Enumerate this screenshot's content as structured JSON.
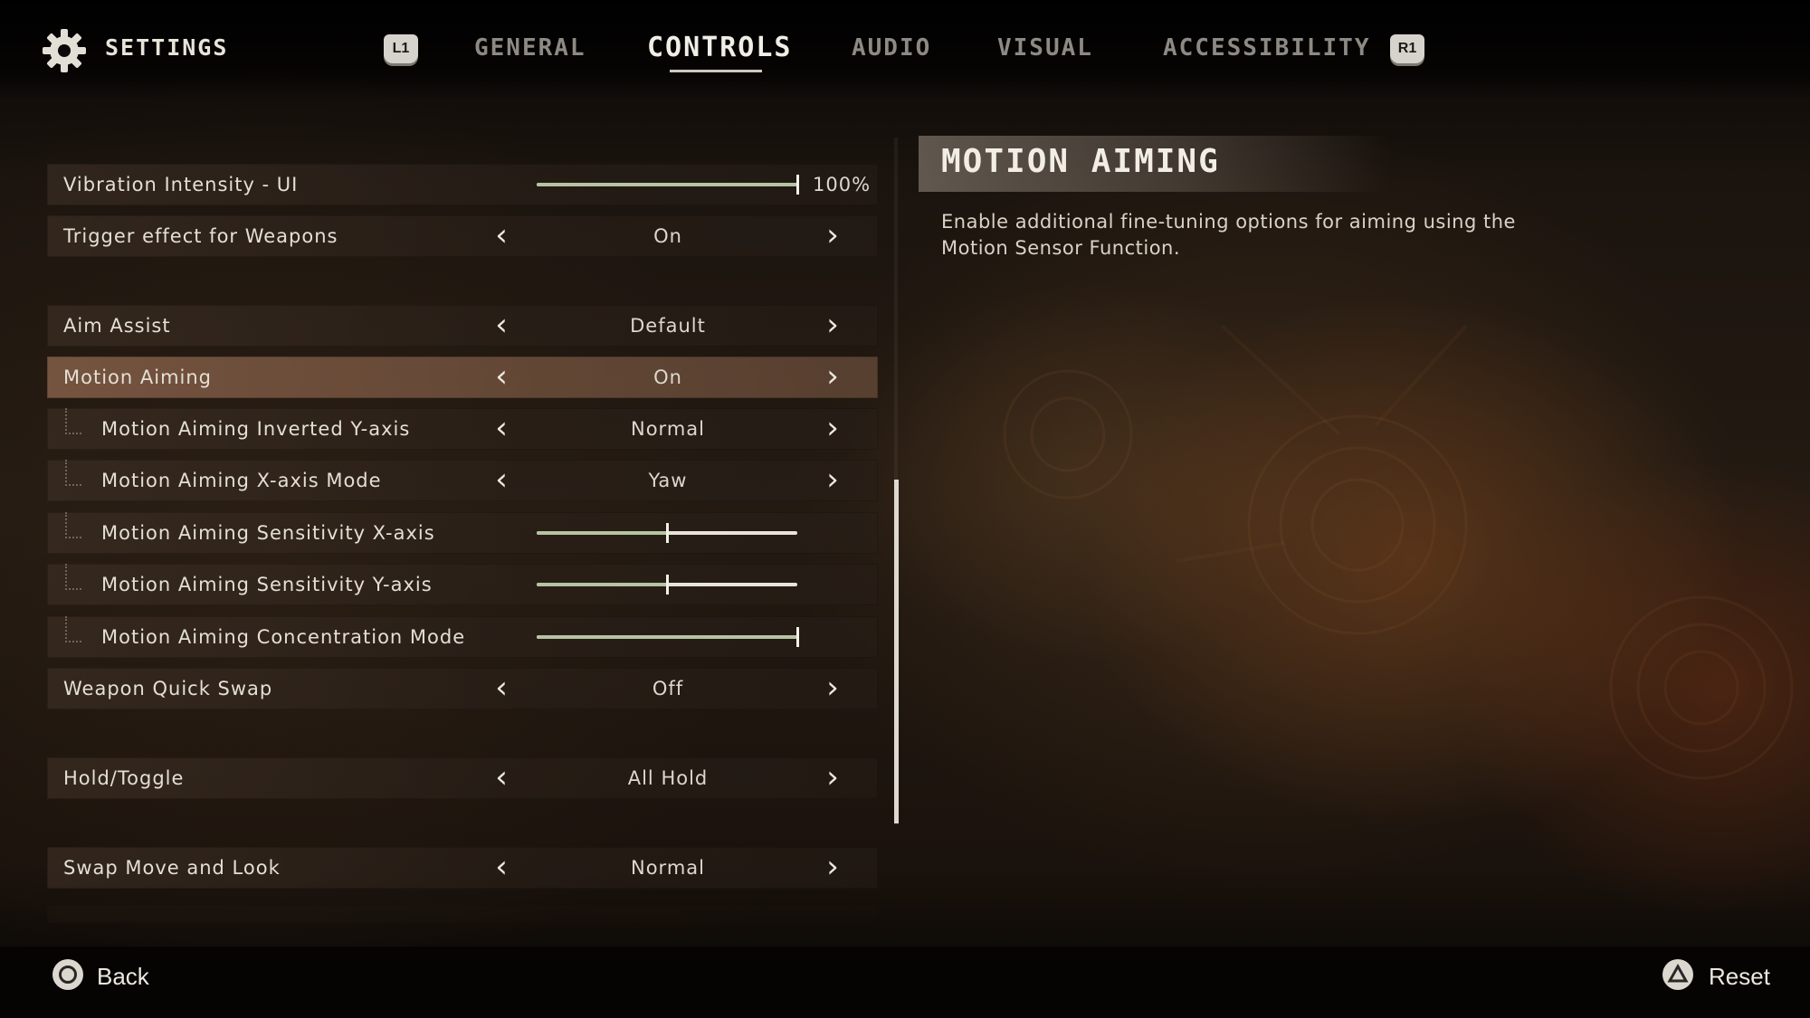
{
  "header": {
    "title": "SETTINGS",
    "bumper_left": "L1",
    "bumper_right": "R1",
    "tabs": [
      {
        "label": "GENERAL",
        "active": false
      },
      {
        "label": "CONTROLS",
        "active": true
      },
      {
        "label": "AUDIO",
        "active": false
      },
      {
        "label": "VISUAL",
        "active": false
      },
      {
        "label": "ACCESSIBILITY",
        "active": false
      }
    ]
  },
  "settings": {
    "vibration_ui": {
      "label": "Vibration Intensity - UI",
      "value_text": "100%",
      "level": 1.0
    },
    "trigger_effect": {
      "label": "Trigger effect for Weapons",
      "value": "On"
    },
    "aim_assist": {
      "label": "Aim Assist",
      "value": "Default"
    },
    "motion_aiming": {
      "label": "Motion Aiming",
      "value": "On",
      "selected": true
    },
    "inverted_y": {
      "label": "Motion Aiming Inverted Y-axis",
      "value": "Normal"
    },
    "x_axis_mode": {
      "label": "Motion Aiming X-axis Mode",
      "value": "Yaw"
    },
    "sensitivity_x": {
      "label": "Motion Aiming Sensitivity X-axis",
      "level": 0.5
    },
    "sensitivity_y": {
      "label": "Motion Aiming Sensitivity Y-axis",
      "level": 0.5
    },
    "concentration": {
      "label": "Motion Aiming Concentration Mode",
      "level": 1.0
    },
    "weapon_swap": {
      "label": "Weapon Quick Swap",
      "value": "Off"
    },
    "hold_toggle": {
      "label": "Hold/Toggle",
      "value": "All Hold"
    },
    "swap_move_look": {
      "label": "Swap Move and Look",
      "value": "Normal"
    }
  },
  "info": {
    "title": "MOTION AIMING",
    "description": "Enable additional fine-tuning options for aiming using the Motion Sensor Function."
  },
  "footer": {
    "back_label": "Back",
    "reset_label": "Reset"
  },
  "colors": {
    "accent_fill": "#b5c4a2",
    "selected_row": "#7c5a44",
    "text": "#e4dfd4"
  }
}
